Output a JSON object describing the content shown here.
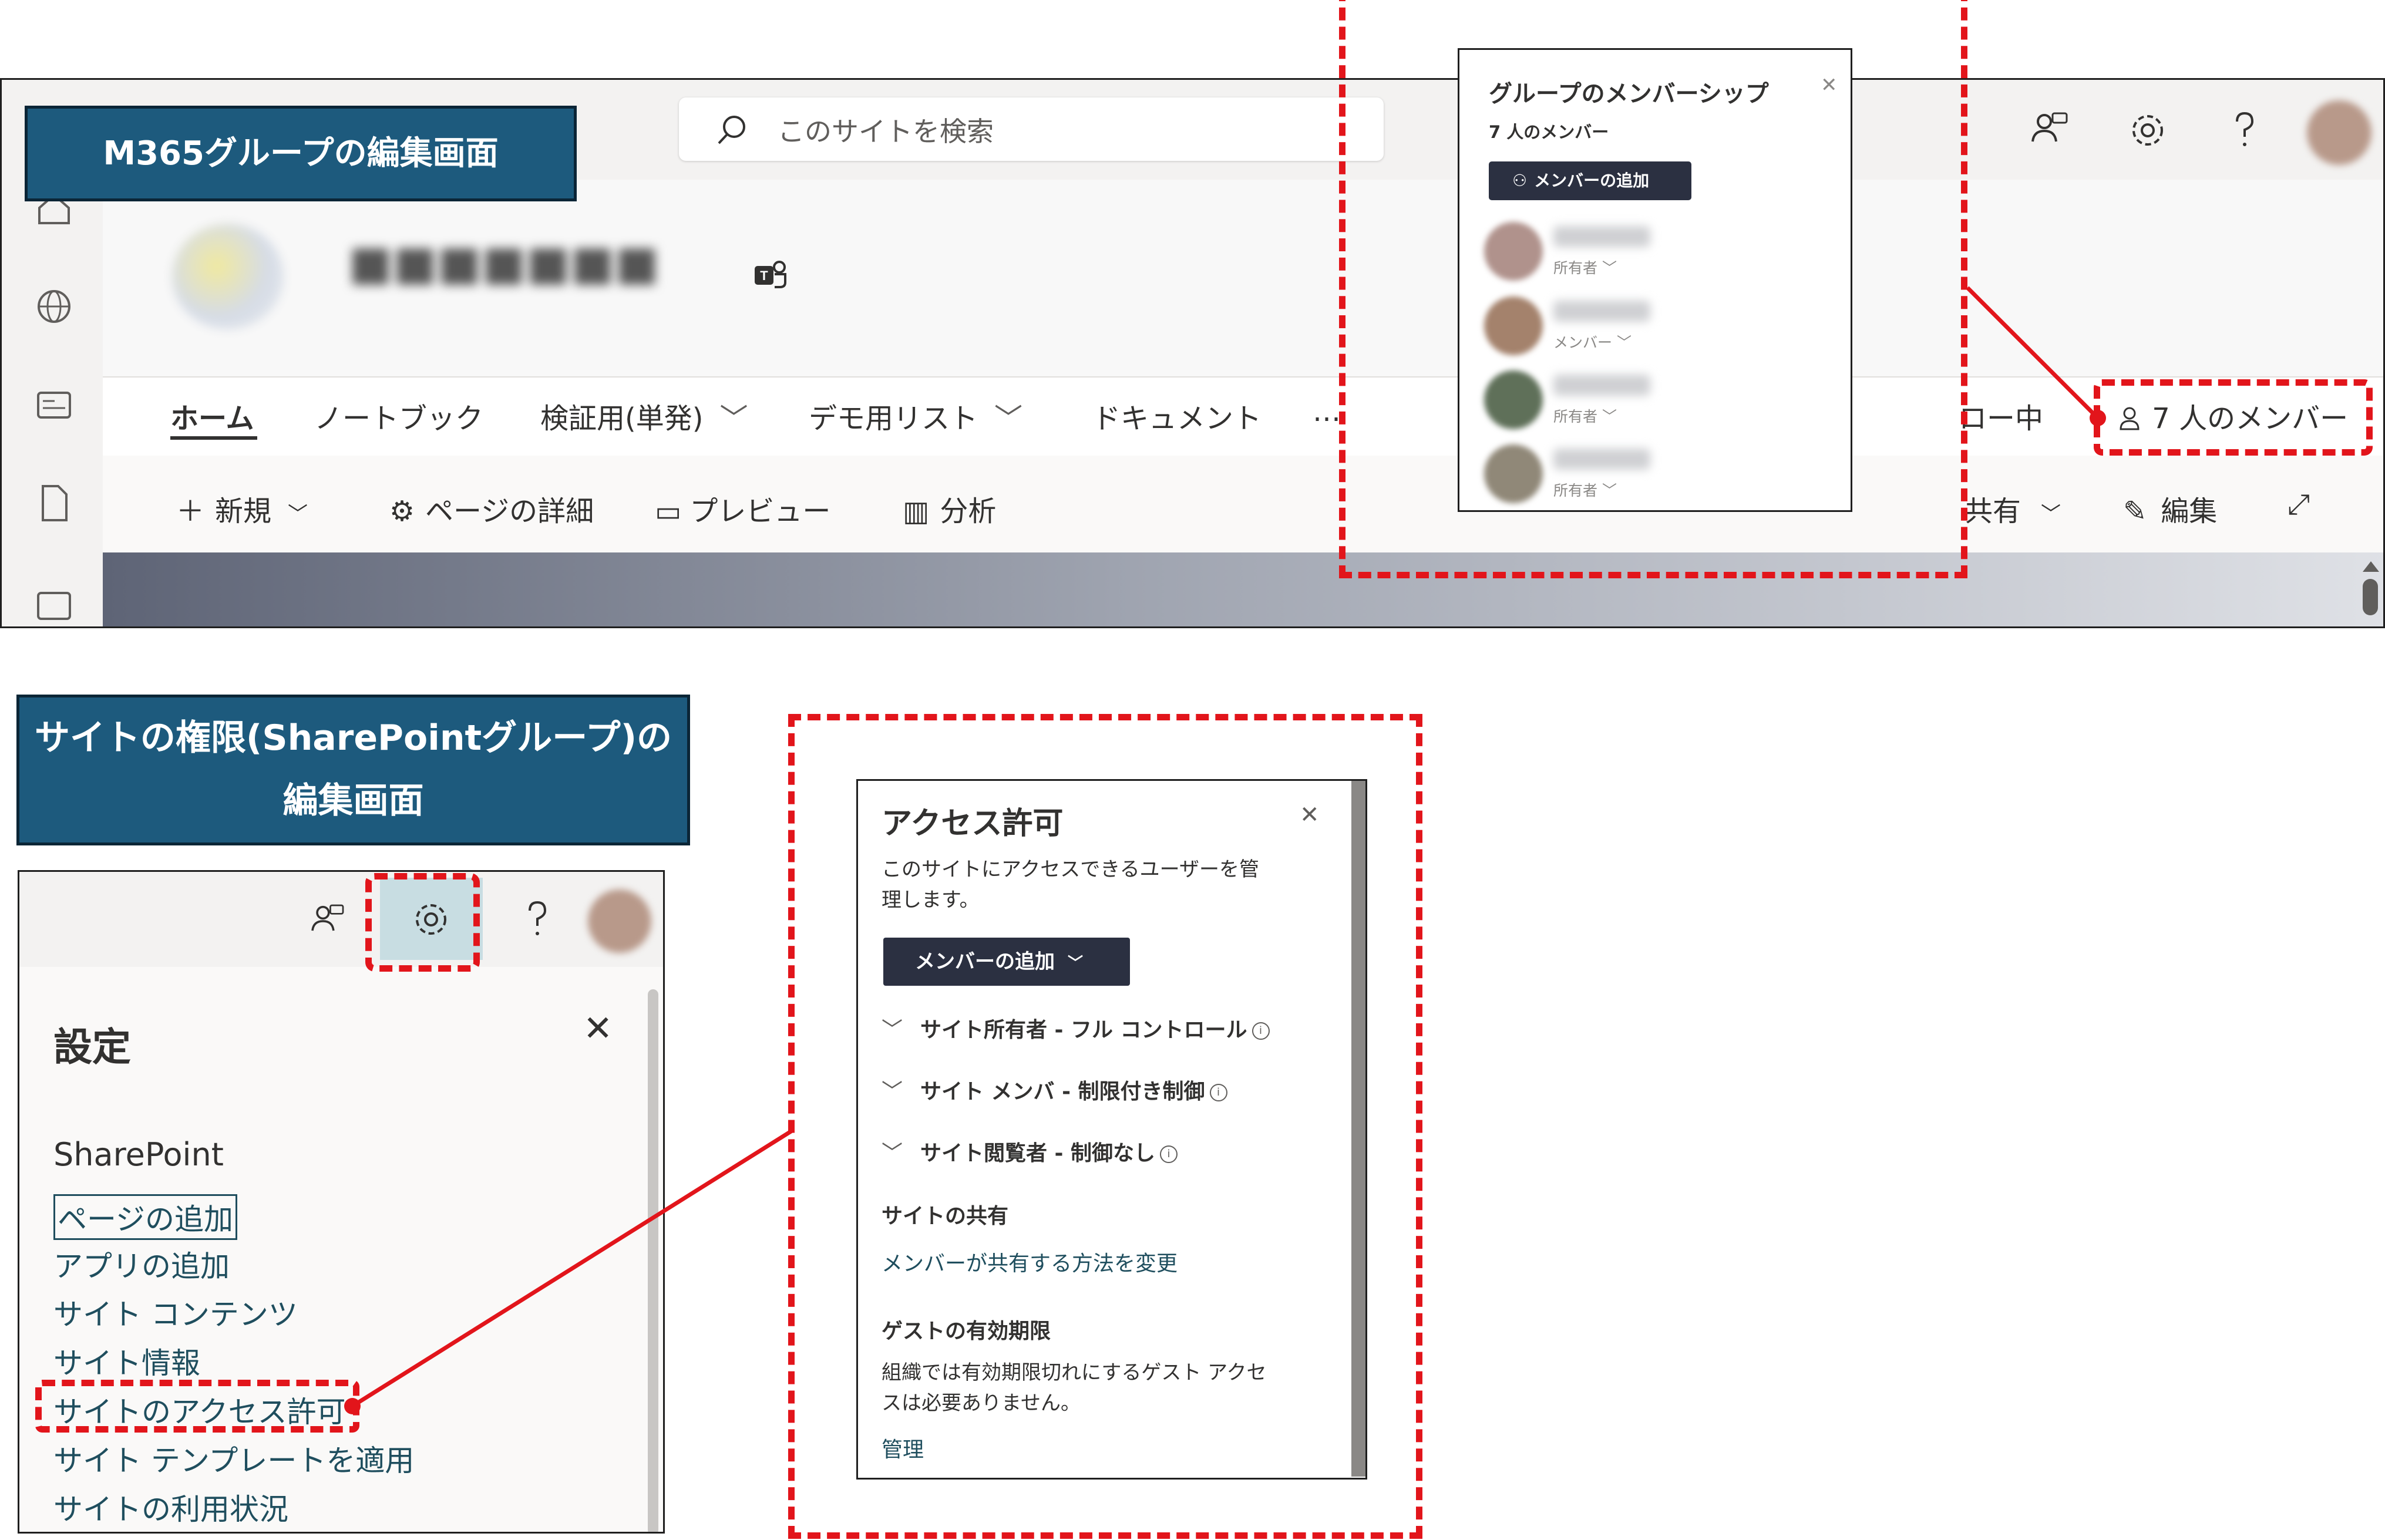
{
  "top": {
    "section_title": "M365グループの編集画面",
    "search_placeholder": "このサイトを検索",
    "nav": {
      "home": "ホーム",
      "notebook": "ノートブック",
      "verification": "検証用(単発)",
      "demo_list": "デモ用リスト",
      "documents": "ドキュメント",
      "more": "…",
      "following": "ロー中",
      "members": "7 人のメンバー"
    },
    "commands": {
      "new": "新規",
      "page_details": "ページの詳細",
      "preview": "プレビュー",
      "analytics": "分析",
      "share": "共有",
      "edit": "編集"
    }
  },
  "group_popup": {
    "title": "グループのメンバーシップ",
    "count": "7 人のメンバー",
    "add_button": "メンバーの追加",
    "members": [
      {
        "role": "所有者"
      },
      {
        "role": "メンバー"
      },
      {
        "role": "所有者"
      },
      {
        "role": "所有者"
      }
    ]
  },
  "bottom": {
    "section_title_line1": "サイトの権限(SharePointグループ)の",
    "section_title_line2": "編集画面"
  },
  "settings": {
    "title": "設定",
    "section": "SharePoint",
    "links": {
      "add_page": "ページの追加",
      "add_app": "アプリの追加",
      "site_contents": "サイト コンテンツ",
      "site_info": "サイト情報",
      "site_permissions": "サイトのアクセス許可",
      "apply_template": "サイト テンプレートを適用",
      "site_usage": "サイトの利用状況"
    }
  },
  "access": {
    "title": "アクセス許可",
    "desc_line1": "このサイトにアクセスできるユーザーを管",
    "desc_line2": "理します。",
    "add_button": "メンバーの追加",
    "owners": "サイト所有者 - フル コントロール",
    "members": "サイト メンバ - 制限付き制御",
    "visitors": "サイト閲覧者 - 制御なし",
    "sharing_heading": "サイトの共有",
    "sharing_link": "メンバーが共有する方法を変更",
    "guest_heading": "ゲストの有効期限",
    "guest_desc_line1": "組織では有効期限切れにするゲスト アクセ",
    "guest_desc_line2": "スは必要ありません。",
    "manage_link": "管理"
  },
  "colors": {
    "title_box": "#1d5a7d",
    "highlight": "#e2151b",
    "button": "#2b3041"
  }
}
